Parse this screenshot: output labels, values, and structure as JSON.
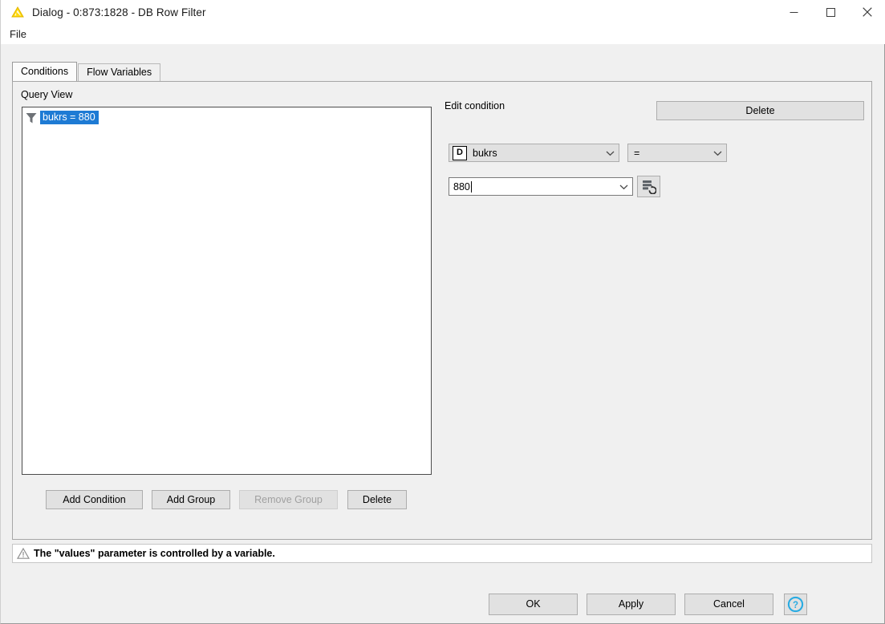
{
  "window": {
    "title": "Dialog - 0:873:1828 - DB Row Filter",
    "icon": "knime-triangle-icon",
    "controls": {
      "minimize": "minimize-icon",
      "maximize": "maximize-icon",
      "close": "close-icon"
    }
  },
  "menubar": {
    "items": [
      {
        "label": "File"
      }
    ]
  },
  "tabs": [
    {
      "label": "Conditions",
      "active": true
    },
    {
      "label": "Flow Variables",
      "active": false
    }
  ],
  "query_view": {
    "label": "Query View",
    "nodes": [
      {
        "icon": "filter-funnel-icon",
        "label": "bukrs = 880",
        "selected": true
      }
    ],
    "selection_color": "#1e7bd4"
  },
  "tree_buttons": {
    "add_condition": "Add Condition",
    "add_group": "Add Group",
    "remove_group": "Remove Group",
    "remove_group_disabled": true,
    "delete": "Delete"
  },
  "edit_condition": {
    "label": "Edit condition",
    "delete_label": "Delete",
    "column": {
      "type_badge": "D",
      "value": "bukrs"
    },
    "operator": {
      "value": "="
    },
    "value_field": {
      "value": "880",
      "has_caret": true
    },
    "db_button_icon": "database-refresh-icon"
  },
  "status": {
    "icon": "warning-triangle-icon",
    "message": "The \"values\" parameter is controlled by a variable."
  },
  "footer": {
    "ok": "OK",
    "apply": "Apply",
    "cancel": "Cancel",
    "help_icon": "help-circle-icon",
    "help_color": "#29abe2"
  }
}
